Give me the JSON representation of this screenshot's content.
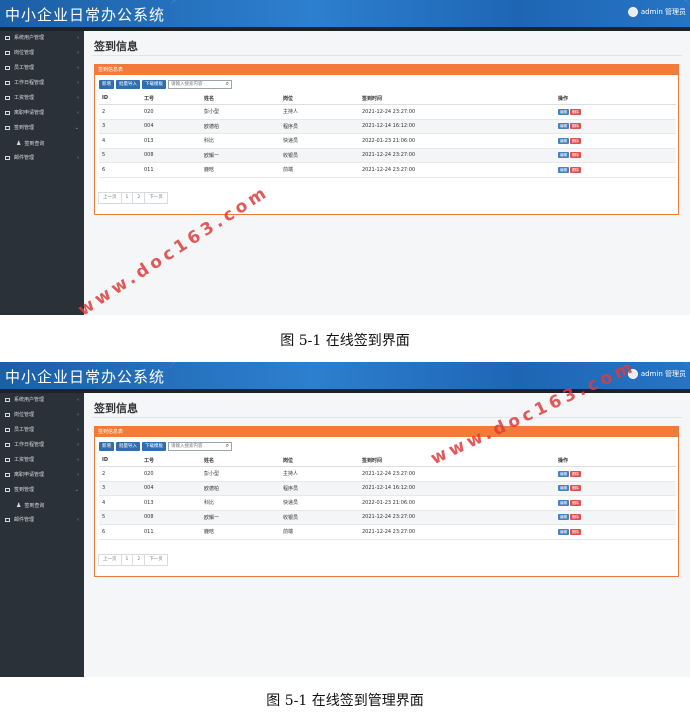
{
  "app_title": "中小企业日常办公系统",
  "user_label": "admin 管理员",
  "sidebar": {
    "items": [
      {
        "label": "系统用户管理"
      },
      {
        "label": "岗位管理"
      },
      {
        "label": "员工管理"
      },
      {
        "label": "工作日程管理"
      },
      {
        "label": "工资管理"
      },
      {
        "label": "离职申请管理"
      },
      {
        "label": "签到管理"
      },
      {
        "label": "签到查询"
      },
      {
        "label": "邮件管理"
      }
    ]
  },
  "page_title": "签到信息",
  "panel_title": "签到信息表",
  "toolbar": {
    "add": "新增",
    "import": "批量导入",
    "template": "下载模板",
    "search_placeholder": "请输入搜索内容"
  },
  "table": {
    "headers": [
      "ID",
      "工号",
      "姓名",
      "岗位",
      "签到时间",
      "操作"
    ],
    "rows": [
      [
        "2",
        "020",
        "彭小型",
        "主持人",
        "2021-12-24 23:27:00"
      ],
      [
        "3",
        "004",
        "欧德柏",
        "程序员",
        "2021-12-14 16:12:00"
      ],
      [
        "4",
        "013",
        "科比",
        "快递员",
        "2022-01-23 21:06:00"
      ],
      [
        "5",
        "008",
        "欧懈一",
        "收银员",
        "2021-12-24 23:27:00"
      ],
      [
        "6",
        "011",
        "鹿晗",
        "前端",
        "2021-12-24 23:27:00"
      ]
    ],
    "edit_label": "编辑",
    "delete_label": "删除"
  },
  "pager": [
    "上一页",
    "1",
    "2",
    "下一页"
  ],
  "captions": [
    "图 5-1  在线签到界面",
    "图 5-1  在线签到管理界面"
  ],
  "watermark": "www.doc163.com",
  "colors": {
    "header_blue": "#1e66b4",
    "sidebar": "#2b3139",
    "panel_orange": "#f47a39",
    "button_blue": "#2f6fb0",
    "delete_red": "#d9534f"
  }
}
